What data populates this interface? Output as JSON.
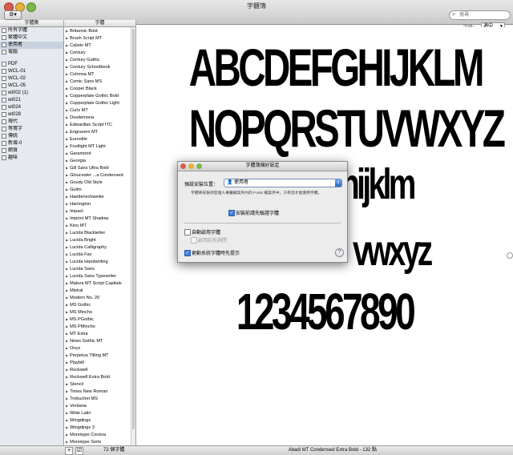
{
  "window": {
    "title": "字體簿"
  },
  "toolbar": {
    "gear": "⚙▾",
    "search_placeholder": "搜尋"
  },
  "columns": {
    "collection": "字體集",
    "font": "字體"
  },
  "collections": [
    {
      "label": "所有字體",
      "icon": "font-icon"
    },
    {
      "label": "繁體中文",
      "icon": "font-icon"
    },
    {
      "label": "使用者",
      "icon": "user-icon",
      "selected": true
    },
    {
      "label": "電腦",
      "icon": "computer-icon"
    }
  ],
  "collections2": [
    {
      "label": "PDF"
    },
    {
      "label": "WCL-01"
    },
    {
      "label": "WCL-02"
    },
    {
      "label": "WCL-05"
    },
    {
      "label": "wt002 (1)"
    },
    {
      "label": "wt021"
    },
    {
      "label": "wt024"
    },
    {
      "label": "wt028"
    },
    {
      "label": "現代"
    },
    {
      "label": "等寬字"
    },
    {
      "label": "傳統"
    },
    {
      "label": "新增-0"
    },
    {
      "label": "網頁"
    },
    {
      "label": "趣味"
    }
  ],
  "fonts": [
    "Britannic Bold",
    "Brush Script MT",
    "Calisto MT",
    "Century",
    "Century Gothic",
    "Century Schoolbook",
    "Colonna MT",
    "Comic Sans MS",
    "Cooper Black",
    "Copperplate Gothic Bold",
    "Copperplate Gothic Light",
    "Curlz MT",
    "Desdemona",
    "Edwardian Script ITC",
    "Engravers MT",
    "Eurostile",
    "Footlight MT Light",
    "Garamond",
    "Georgia",
    "Gill Sans Ultra Bold",
    "Gloucester ...a Condensed",
    "Goudy Old Style",
    "Gulim",
    "Haettenschweiler",
    "Harrington",
    "Impact",
    "Imprint MT Shadow",
    "Kino MT",
    "Lucida Blackletter",
    "Lucida Bright",
    "Lucida Calligraphy",
    "Lucida Fax",
    "Lucida Handwriting",
    "Lucida Sans",
    "Lucida Sans Typewriter",
    "Matura MT Script Capitals",
    "Mistral",
    "Modern No. 20",
    "MS Gothic",
    "MS Mincho",
    "MS PGothic",
    "MS PMincho",
    "MT Extra",
    "News Gothic MT",
    "Onyx",
    "Perpetua Titling MT",
    "Playbill",
    "Rockwell",
    "Rockwell Extra Bold",
    "Stencil",
    "Times New Roman",
    "Trebuchet MS",
    "Verdana",
    "Wide Latin",
    "Wingdings",
    "Wingdings 3",
    "Monotype Corsiva",
    "Monotype Sorts"
  ],
  "preview": {
    "size_label": "字級：",
    "size_value": "適中",
    "line1": "ABCDEFGHIJKLM",
    "line2": "NOPQRSTUVWXYZ",
    "line3_visible": "hijklm",
    "line4_visible": "vwxyz",
    "line5": "1234567890"
  },
  "status": {
    "add": "+",
    "check": "☑",
    "count": "72 個字體",
    "font_info": "Abadi MT Condensed Extra Bold - 132 點"
  },
  "dialog": {
    "title": "字體簿偏好設定",
    "location_label": "預設安裝位置：",
    "location_value": "使用者",
    "location_desc": "字體將安裝到您個人專屬檔案夾內的 Fonts 檔案夾中，只有您才能使用字體。",
    "validate_label": "安裝前請先驗證字體",
    "auto_activate_label": "自動啟用字體",
    "ask_first_label": "啟用前先詢問",
    "alert_label": "更動系統字體時先提示",
    "help": "?"
  }
}
